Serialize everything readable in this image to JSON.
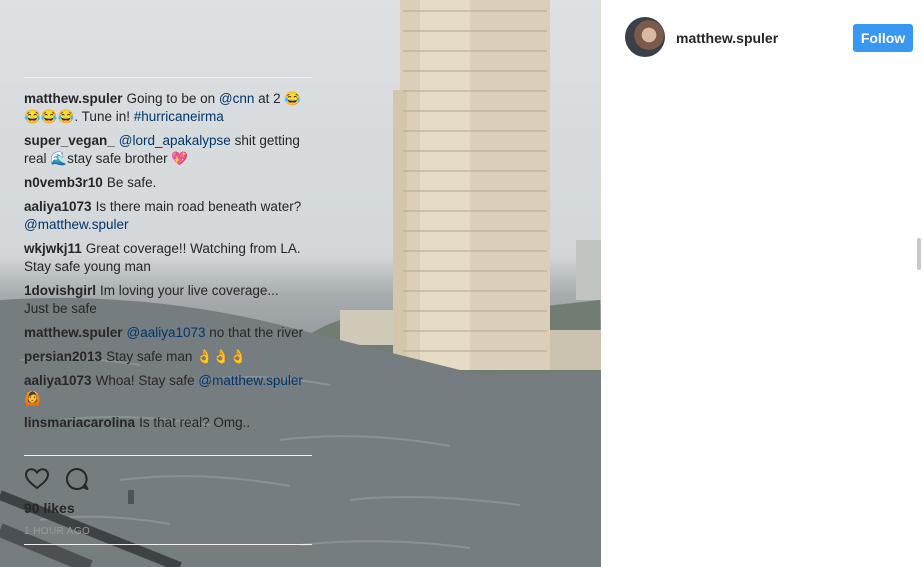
{
  "post": {
    "image_alt": "Flooded waterfront with high-rise tower in hurricane rain"
  },
  "header": {
    "username": "matthew.spuler",
    "follow_label": "Follow"
  },
  "comments": [
    {
      "author": "matthew.spuler",
      "parts": [
        {
          "t": "Going to be on "
        },
        {
          "t": "@cnn",
          "m": true
        },
        {
          "t": " at 2 😂😂😂😂. Tune in! "
        },
        {
          "t": "#hurricaneirma",
          "m": true
        }
      ]
    },
    {
      "author": "super_vegan_",
      "parts": [
        {
          "t": "@lord_apakalypse",
          "m": true
        },
        {
          "t": " shit getting real 🌊stay safe brother 💖"
        }
      ]
    },
    {
      "author": "n0vemb3r10",
      "parts": [
        {
          "t": "Be safe."
        }
      ]
    },
    {
      "author": "aaliya1073",
      "parts": [
        {
          "t": "Is there main road beneath water?"
        },
        {
          "t": "@matthew.spuler",
          "m": true
        }
      ]
    },
    {
      "author": "wkjwkj11",
      "parts": [
        {
          "t": "Great coverage!! Watching from LA. Stay safe young man"
        }
      ]
    },
    {
      "author": "1dovishgirl",
      "parts": [
        {
          "t": "Im loving your live coverage... Just be safe"
        }
      ]
    },
    {
      "author": "matthew.spuler",
      "parts": [
        {
          "t": "@aaliya1073",
          "m": true
        },
        {
          "t": " no that the river"
        }
      ]
    },
    {
      "author": "persian2013",
      "parts": [
        {
          "t": "Stay safe man 👌👌👌"
        }
      ]
    },
    {
      "author": "aaliya1073",
      "parts": [
        {
          "t": "Whoa! Stay safe "
        },
        {
          "t": "@matthew.spuler",
          "m": true
        },
        {
          "t": " 🙆"
        }
      ]
    },
    {
      "author": "linsmariacarolina",
      "parts": [
        {
          "t": "Is that real? Omg.."
        }
      ]
    }
  ],
  "actions": {
    "like_icon": "heart-icon",
    "comment_icon": "comment-bubble-icon"
  },
  "likes_text": "90 likes",
  "time_ago": "1 HOUR AGO",
  "colors": {
    "follow_button": "#3897f0",
    "mention": "#003569",
    "text": "#262626",
    "muted": "#999999"
  }
}
